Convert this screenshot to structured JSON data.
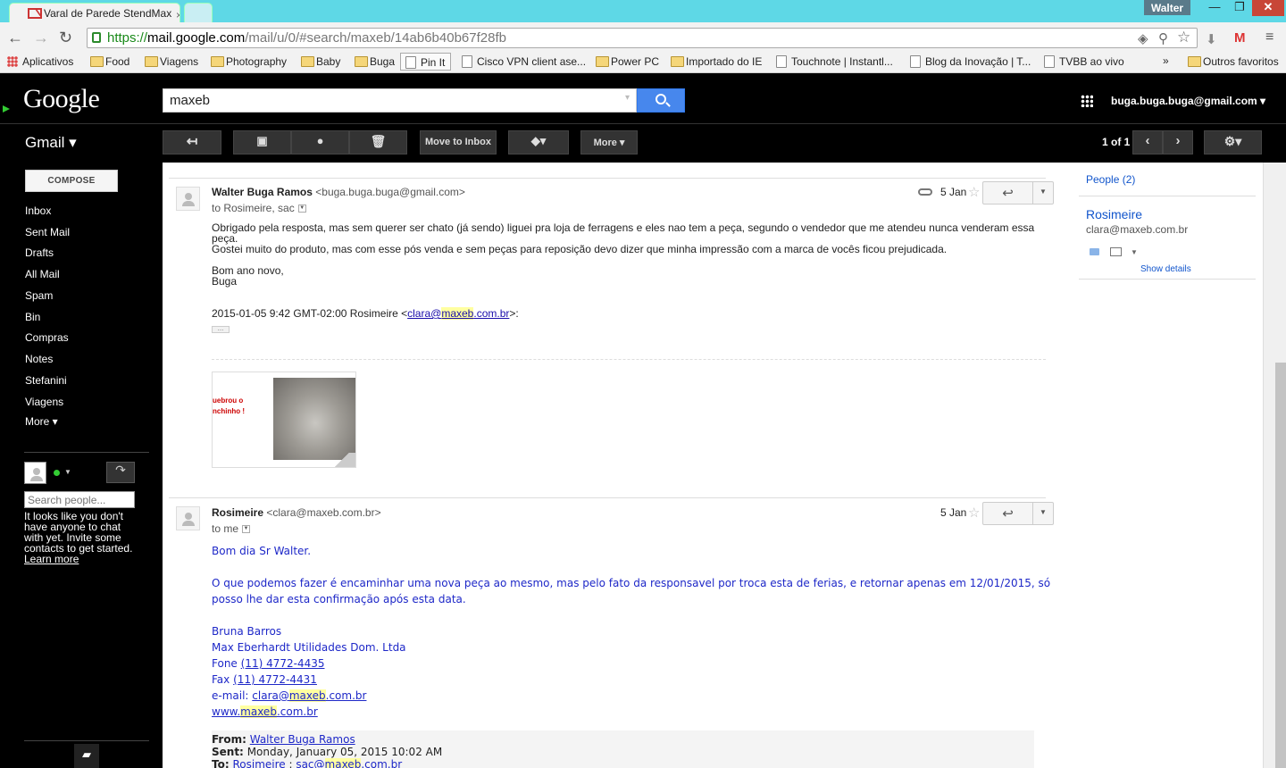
{
  "browser": {
    "tab_title": "Varal de Parede StendMax",
    "tab_close": "×",
    "user_badge": "Walter",
    "url_https": "https://",
    "url_host": "mail.google.com",
    "url_path": "/mail/u/0/#search/maxeb/14ab6b40b67f28fb",
    "bookmarks": [
      "Aplicativos",
      "Food",
      "Viagens",
      "Photography",
      "Baby",
      "Buga",
      "Pin It",
      "Cisco VPN client ase...",
      "Power PC",
      "Importado do IE",
      "Touchnote | Instantl...",
      "Blog da Inovação | T...",
      "TVBB ao vivo"
    ],
    "bookmarks_more": "»",
    "bookmarks_other": "Outros favoritos"
  },
  "header": {
    "logo": "Google",
    "search_value": "maxeb",
    "account": "buga.buga.buga@gmail.com ▾"
  },
  "toolbar": {
    "gmail_label": "Gmail ▾",
    "move_to_inbox": "Move to Inbox",
    "more": "More ▾",
    "pager": "1 of 1"
  },
  "sidebar": {
    "compose": "COMPOSE",
    "items": [
      "Inbox",
      "Sent Mail",
      "Drafts",
      "All Mail",
      "Spam",
      "Bin",
      "Compras",
      "Notes",
      "Stefanini",
      "Viagens",
      "More ▾"
    ],
    "search_people_placeholder": "Search people...",
    "chat_message": "It looks like you don't have anyone to chat with yet. Invite some contacts to get started.",
    "learn_more": "Learn more"
  },
  "message1": {
    "sender_name": "Walter Buga Ramos",
    "sender_email": "<buga.buga.buga@gmail.com>",
    "recipients": "to Rosimeire, sac",
    "date": "5 Jan",
    "para1": "Obrigado pela resposta, mas sem querer ser chato (já sendo) liguei pra loja de ferragens e eles nao tem a peça, segundo o vendedor que me atendeu nunca venderam essa peça.",
    "para2": "Gostei muito do produto, mas com esse pós venda e sem peças para reposição devo dizer que minha impressão com a marca de vocês ficou prejudicada.",
    "sign1": "Bom ano novo,",
    "sign2": "Buga",
    "quote_pre": "2015-01-05 9:42 GMT-02:00 Rosimeire <",
    "quote_link_a": "clara@",
    "quote_link_b": "maxeb",
    "quote_link_c": ".com.br",
    "quote_post": ">:",
    "dots": "...",
    "attachment_text_1": "uebrou o",
    "attachment_text_2": "nchinho !"
  },
  "message2": {
    "sender_name": "Rosimeire",
    "sender_email": "<clara@maxeb.com.br>",
    "recipients": "to me",
    "date": "5 Jan",
    "greeting": "Bom dia Sr Walter.",
    "body1": "O que podemos fazer é encaminhar uma nova peça ao mesmo, mas pelo fato da responsavel por troca esta de ferias, e retornar apenas em 12/01/2015, só",
    "body2": "posso lhe dar esta confirmação após esta data.",
    "sig_name": "Bruna Barros",
    "sig_company": "Max Eberhardt Utilidades Dom. Ltda",
    "fone_label": "Fone ",
    "fone_number": "(11) 4772-4435",
    "fax_label": "Fax ",
    "fax_number": "(11) 4772-4431",
    "email_label": "e-mail: ",
    "email_a": "clara@",
    "email_b": "maxeb",
    "email_c": ".com.br",
    "web_a": "www.",
    "web_b": "maxeb",
    "web_c": ".com.br",
    "from_label": "From:",
    "from_value": "Walter Buga Ramos",
    "sent_label": "Sent:",
    "sent_value": "Monday, January 05, 2015 10:02 AM",
    "to_label": "To:",
    "to_value_1": "Rosimeire",
    "to_sep": " ; ",
    "to_value_2a": "sac@",
    "to_value_2b": "maxeb",
    "to_value_2c": ".com.br"
  },
  "people_panel": {
    "label": "People (2)",
    "contact_name": "Rosimeire",
    "contact_email": "clara@maxeb.com.br",
    "show_details": "Show details"
  }
}
